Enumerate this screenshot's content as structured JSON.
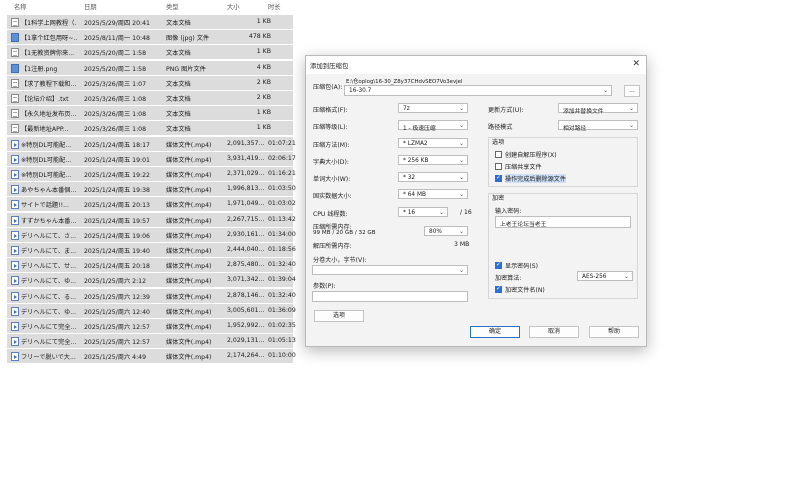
{
  "file_list": {
    "headers": {
      "name": "名称",
      "date": "日期",
      "type": "类型",
      "size": "大小",
      "duration": "时长"
    },
    "rows": [
      {
        "icon": "doc",
        "name": "【1科学上网教程（...",
        "date": "2025/5/29/周四 20:41",
        "type": "文本文档",
        "size": "1 KB",
        "duration": ""
      },
      {
        "icon": "img",
        "name": "【1拿个红包用呀~...",
        "date": "2025/8/11/周一 10:48",
        "type": "图像 (jpg) 文件",
        "size": "478 KB",
        "duration": ""
      },
      {
        "icon": "doc",
        "name": "【1无教资牌你来...",
        "date": "2025/5/20/周二 1:58",
        "type": "文本文档",
        "size": "1 KB",
        "duration": ""
      },
      {
        "icon": "img",
        "name": "【1注册.png",
        "date": "2025/5/20/周二 1:58",
        "type": "PNG 图片文件",
        "size": "4 KB",
        "duration": ""
      },
      {
        "icon": "doc",
        "name": "【求了教程下载和...",
        "date": "2025/3/26/周三 1:07",
        "type": "文本文档",
        "size": "2 KB",
        "duration": ""
      },
      {
        "icon": "doc",
        "name": "【论坛介绍】.txt",
        "date": "2025/3/26/周三 1:08",
        "type": "文本文档",
        "size": "2 KB",
        "duration": ""
      },
      {
        "icon": "doc",
        "name": "【永久地址发布页...",
        "date": "2025/3/26/周三 1:08",
        "type": "文本文档",
        "size": "1 KB",
        "duration": ""
      },
      {
        "icon": "doc",
        "name": "【最新地址APP...",
        "date": "2025/3/26/周三 1:08",
        "type": "文本文档",
        "size": "1 KB",
        "duration": ""
      },
      {
        "icon": "vid",
        "name": "※特別DL可能配...",
        "date": "2025/1/24/周五 18:17",
        "type": "媒体文件(.mp4)",
        "size": "2,091,357...",
        "duration": "01:07:21"
      },
      {
        "icon": "vid",
        "name": "※特別DL可能配...",
        "date": "2025/1/24/周五 19:01",
        "type": "媒体文件(.mp4)",
        "size": "3,931,419...",
        "duration": "02:06:17"
      },
      {
        "icon": "vid",
        "name": "※特別DL可能配...",
        "date": "2025/1/24/周五 19:22",
        "type": "媒体文件(.mp4)",
        "size": "2,371,029...",
        "duration": "01:16:21"
      },
      {
        "icon": "vid",
        "name": "あやちゃん本番個...",
        "date": "2025/1/24/周五 19:38",
        "type": "媒体文件(.mp4)",
        "size": "1,996,813...",
        "duration": "01:03:50"
      },
      {
        "icon": "vid",
        "name": "サイトで話題!!...",
        "date": "2025/1/24/周五 20:13",
        "type": "媒体文件(.mp4)",
        "size": "1,971,049...",
        "duration": "01:03:02"
      },
      {
        "icon": "vid",
        "name": "すずかちゃん本番...",
        "date": "2025/1/24/周五 19:57",
        "type": "媒体文件(.mp4)",
        "size": "2,267,715...",
        "duration": "01:13:42"
      },
      {
        "icon": "vid",
        "name": "デリヘルにて、さ...",
        "date": "2025/1/24/周五 19:06",
        "type": "媒体文件(.mp4)",
        "size": "2,930,161...",
        "duration": "01:34:00"
      },
      {
        "icon": "vid",
        "name": "デリヘルにて、ま...",
        "date": "2025/1/24/周五 19:40",
        "type": "媒体文件(.mp4)",
        "size": "2,444,040...",
        "duration": "01:18:56"
      },
      {
        "icon": "vid",
        "name": "デリヘルにて、せ...",
        "date": "2025/1/24/周五 20:18",
        "type": "媒体文件(.mp4)",
        "size": "2,875,480...",
        "duration": "01:32:40"
      },
      {
        "icon": "vid",
        "name": "デリヘルにて、ゆ...",
        "date": "2025/1/25/周六 2:12",
        "type": "媒体文件(.mp4)",
        "size": "3,071,342...",
        "duration": "01:39:04"
      },
      {
        "icon": "vid",
        "name": "デリヘルにて、る...",
        "date": "2025/1/25/周六 12:39",
        "type": "媒体文件(.mp4)",
        "size": "2,878,146...",
        "duration": "01:32:40"
      },
      {
        "icon": "vid",
        "name": "デリヘルにて、ゆ...",
        "date": "2025/1/25/周六 12:40",
        "type": "媒体文件(.mp4)",
        "size": "3,005,601...",
        "duration": "01:36:09"
      },
      {
        "icon": "vid",
        "name": "デリヘルにて完全...",
        "date": "2025/1/25/周六 12:57",
        "type": "媒体文件(.mp4)",
        "size": "1,952,992...",
        "duration": "01:02:35"
      },
      {
        "icon": "vid",
        "name": "デリヘルにて完全...",
        "date": "2025/1/25/周六 12:57",
        "type": "媒体文件(.mp4)",
        "size": "2,029,131...",
        "duration": "01:05:13"
      },
      {
        "icon": "vid",
        "name": "フリーで脱いで大...",
        "date": "2025/1/25/周六 4:49",
        "type": "媒体文件(.mp4)",
        "size": "2,174,264...",
        "duration": "01:10:00"
      }
    ]
  },
  "dialog": {
    "title": "添加到压缩包",
    "close_glyph": "✕",
    "archive_label": "压缩包(A):",
    "archive_path": "E:\\仓oplog\\16-30_Z8y37CHdvSEO7Vo3evjel",
    "archive_name": "16-30.7",
    "browse_label": "...",
    "format_label": "压缩格式(F):",
    "format_value": "7z",
    "level_label": "压缩等级(L):",
    "level_value": "1 - 极速压缩",
    "method_label": "压缩方法(M):",
    "method_value": "* LZMA2",
    "dict_label": "字典大小(D):",
    "dict_value": "* 256 KB",
    "word_label": "单词大小(W):",
    "word_value": "* 32",
    "solid_label": "固实数据大小:",
    "solid_value": "* 64 MB",
    "threads_label": "CPU 线程数:",
    "threads_value": "* 16",
    "threads_max": "/ 16",
    "mem_label": "压缩所需内存:",
    "mem_detail": "99 MB / 20 GB / 32 GB",
    "mem_percent": "80%",
    "decomp_label": "解压所需内存:",
    "decomp_value": "3 MB",
    "split_label": "分卷大小，字节(V):",
    "split_value": "",
    "params_label": "参数(P):",
    "params_value": "",
    "options_btn": "选项",
    "update_label": "更新方式(U):",
    "update_value": "添加并替换文件",
    "path_label": "路径模式",
    "path_value": "相对路径",
    "options_group": "选项",
    "opt_sfx": "创建自解压程序(X)",
    "opt_shared": "压缩共享文件",
    "opt_delete": "操作完成后删除源文件",
    "encrypt_group": "加密",
    "password_label": "输入密码:",
    "password_value": "上老王论坛当老王",
    "show_password": "显示密码(S)",
    "enc_method_label": "加密算法:",
    "enc_method_value": "AES-256",
    "encrypt_names": "加密文件名(N)",
    "ok": "确定",
    "cancel": "取消",
    "help": "帮助"
  },
  "colors": {
    "row_bg": "#dcdcdc",
    "accent": "#2f6fd4",
    "dialog_bg": "#f3f3f3"
  }
}
